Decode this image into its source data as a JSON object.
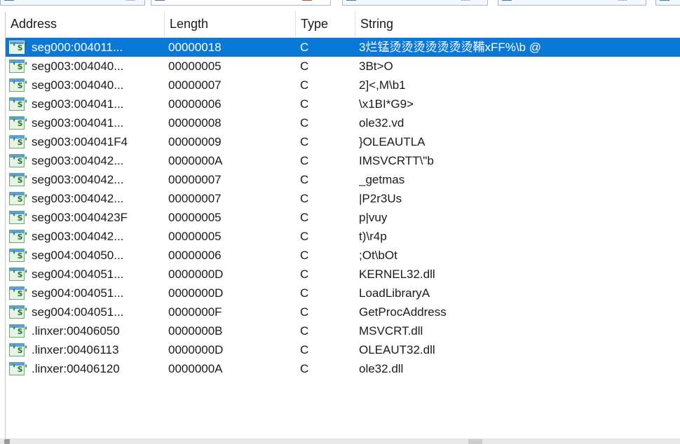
{
  "columns": [
    "Address",
    "Length",
    "Type",
    "String"
  ],
  "selected_row": 0,
  "rows": [
    {
      "icon": "'s'",
      "address": "seg000:004011...",
      "length": "00000018",
      "type": "C",
      "string": "3烂锰烫烫烫烫烫烫烫鞴xFF%\\b @"
    },
    {
      "icon": "'s'",
      "address": "seg003:004040...",
      "length": "00000005",
      "type": "C",
      "string": "3Bt>O"
    },
    {
      "icon": "'s'",
      "address": "seg003:004040...",
      "length": "00000007",
      "type": "C",
      "string": "2]<,M\\b1"
    },
    {
      "icon": "'s'",
      "address": "seg003:004041...",
      "length": "00000006",
      "type": "C",
      "string": "\\x1BI*G9>"
    },
    {
      "icon": "'s'",
      "address": "seg003:004041...",
      "length": "00000008",
      "type": "C",
      "string": "ole32.vd"
    },
    {
      "icon": "'s'",
      "address": "seg003:004041F4",
      "length": "00000009",
      "type": "C",
      "string": "}OLEAUTLA"
    },
    {
      "icon": "'s'",
      "address": "seg003:004042...",
      "length": "0000000A",
      "type": "C",
      "string": "IMSVCRTT\\\"b"
    },
    {
      "icon": "'s'",
      "address": "seg003:004042...",
      "length": "00000007",
      "type": "C",
      "string": "_getmas"
    },
    {
      "icon": "'s'",
      "address": "seg003:004042...",
      "length": "00000007",
      "type": "C",
      "string": "|P2r3Us"
    },
    {
      "icon": "'s'",
      "address": "seg003:0040423F",
      "length": "00000005",
      "type": "C",
      "string": "p|vuy"
    },
    {
      "icon": "'s'",
      "address": "seg003:004042...",
      "length": "00000005",
      "type": "C",
      "string": "t)\\r4p"
    },
    {
      "icon": "'s'",
      "address": "seg004:004050...",
      "length": "00000006",
      "type": "C",
      "string": ";Ot\\bOt"
    },
    {
      "icon": "'s'",
      "address": "seg004:004051...",
      "length": "0000000D",
      "type": "C",
      "string": "KERNEL32.dll"
    },
    {
      "icon": "'s'",
      "address": "seg004:004051...",
      "length": "0000000D",
      "type": "C",
      "string": "LoadLibraryA"
    },
    {
      "icon": "'s'",
      "address": "seg004:004051...",
      "length": "0000000F",
      "type": "C",
      "string": "GetProcAddress"
    },
    {
      "icon": "'s'",
      "address": ".linxer:00406050",
      "length": "0000000B",
      "type": "C",
      "string": "MSVCRT.dll"
    },
    {
      "icon": "'s'",
      "address": ".linxer:00406113",
      "length": "0000000D",
      "type": "C",
      "string": "OLEAUT32.dll"
    },
    {
      "icon": "'s'",
      "address": ".linxer:00406120",
      "length": "0000000A",
      "type": "C",
      "string": "ole32.dll"
    }
  ],
  "colors": {
    "selection": "#0a78d7",
    "icon_letter": "#1f7a1f",
    "header_text": "#1a1a1a"
  },
  "icons": {
    "string_row": "string-literal-icon"
  }
}
